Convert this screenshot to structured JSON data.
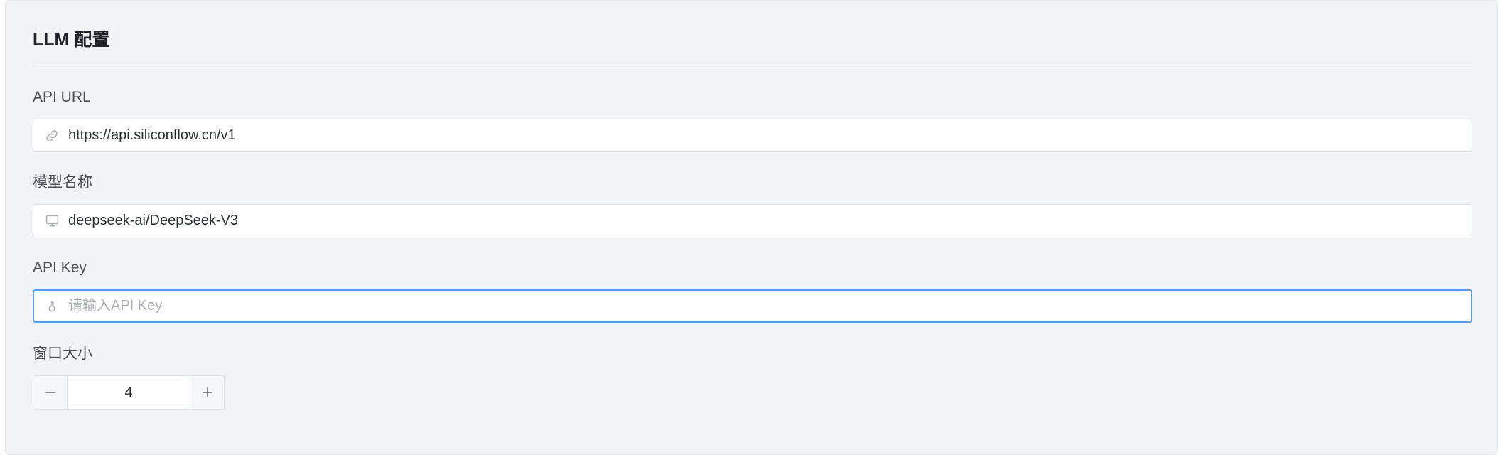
{
  "section": {
    "title": "LLM 配置"
  },
  "fields": {
    "api_url": {
      "label": "API URL",
      "value": "https://api.siliconflow.cn/v1",
      "icon": "link-icon"
    },
    "model_name": {
      "label": "模型名称",
      "value": "deepseek-ai/DeepSeek-V3",
      "icon": "monitor-icon"
    },
    "api_key": {
      "label": "API Key",
      "value": "",
      "placeholder": "请输入API Key",
      "icon": "key-icon"
    },
    "window_size": {
      "label": "窗口大小",
      "value": "4",
      "decrement": "−",
      "increment": "+"
    }
  },
  "colors": {
    "panel_bg": "#f2f3f5",
    "focus_border": "#5b9ce8",
    "label_text": "#4a4f57",
    "placeholder_text": "#a8abb2"
  }
}
